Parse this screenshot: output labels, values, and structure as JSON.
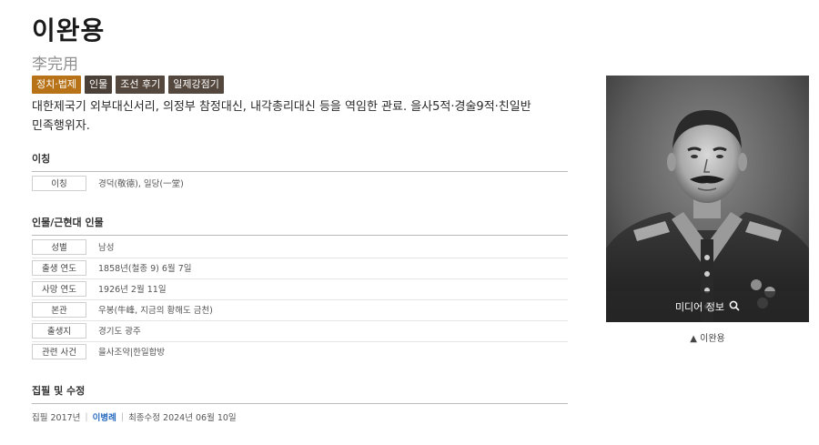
{
  "entry": {
    "title": "이완용",
    "hanja": "李完用",
    "tags": [
      "정치·법제",
      "인물",
      "조선 후기",
      "일제강점기"
    ],
    "description": "대한제국기 외부대신서리, 의정부 참정대신, 내각총리대신 등을 역임한 관료. 을사5적·경술9적·친일반민족행위자."
  },
  "alias_section": {
    "heading": "이칭",
    "rows": [
      {
        "label": "이칭",
        "value": "경덕(敬德), 일당(一堂)"
      }
    ]
  },
  "person_section": {
    "heading": "인물/근현대 인물",
    "rows": [
      {
        "label": "성별",
        "value": "남성"
      },
      {
        "label": "출생 연도",
        "value": "1858년(철종 9) 6월 7일"
      },
      {
        "label": "사망 연도",
        "value": "1926년 2월 11일"
      },
      {
        "label": "본관",
        "value": "우봉(牛峰, 지금의 황해도 금천)"
      },
      {
        "label": "출생지",
        "value": "경기도 광주"
      },
      {
        "label": "관련 사건",
        "value": "을사조약|한일합방"
      }
    ]
  },
  "writing_section": {
    "heading": "집필 및 수정",
    "written_label": "집필 2017년",
    "author": "이병례",
    "revised_label": "최종수정 2024년 06월 10일"
  },
  "media": {
    "info_label": "미디어 정보",
    "caption": "▲ 이완용"
  }
}
